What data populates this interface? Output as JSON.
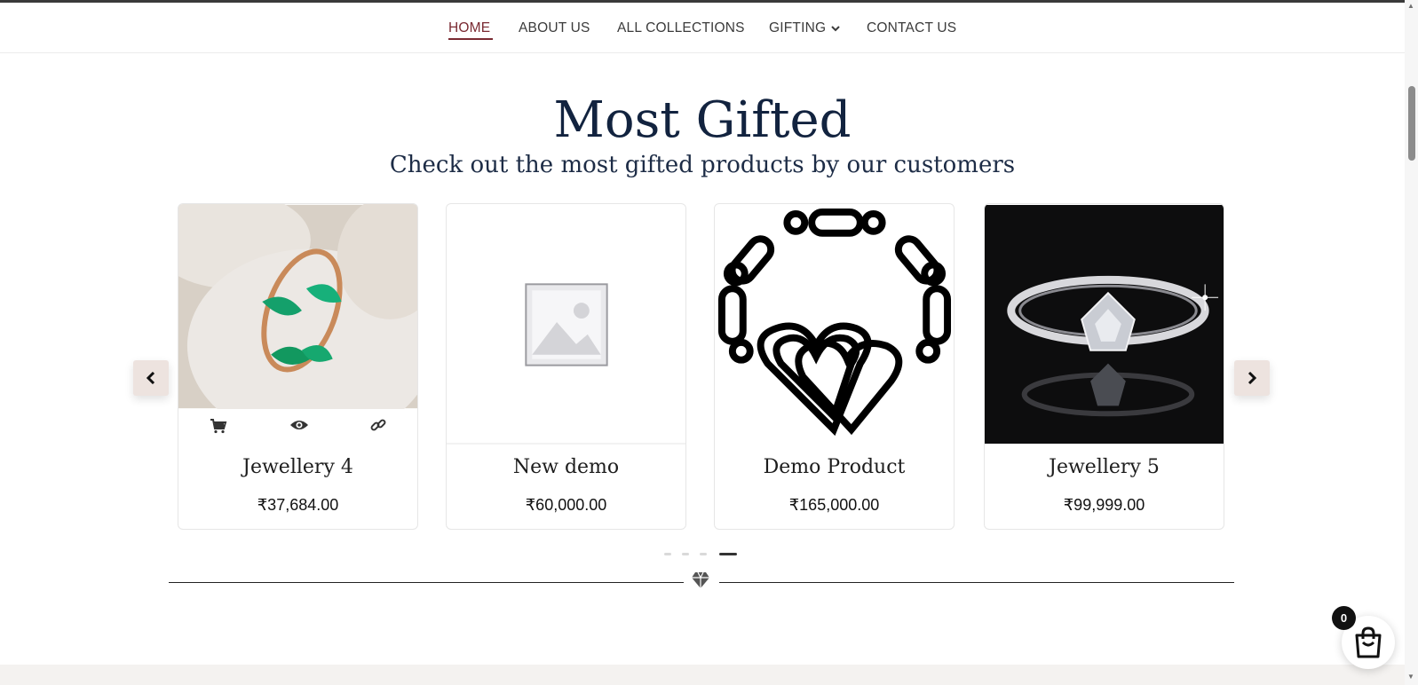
{
  "nav": {
    "items": [
      {
        "label": "HOME"
      },
      {
        "label": "ABOUT US"
      },
      {
        "label": "ALL COLLECTIONS"
      },
      {
        "label": "GIFTING"
      },
      {
        "label": "CONTACT US"
      }
    ]
  },
  "section": {
    "title": "Most Gifted",
    "subtitle": "Check out the most gifted products by our customers"
  },
  "products": [
    {
      "name": "Jewellery 4",
      "price": "₹37,684.00"
    },
    {
      "name": "New demo",
      "price": "₹60,000.00"
    },
    {
      "name": "Demo Product",
      "price": "₹165,000.00"
    },
    {
      "name": "Jewellery 5",
      "price": "₹99,999.00"
    }
  ],
  "carousel": {
    "page_count": 4,
    "active_page": 4
  },
  "cart": {
    "count": "0"
  },
  "colors": {
    "accent": "#7a2a32",
    "heading": "#12233f",
    "arrow_bg": "#ede3df"
  }
}
